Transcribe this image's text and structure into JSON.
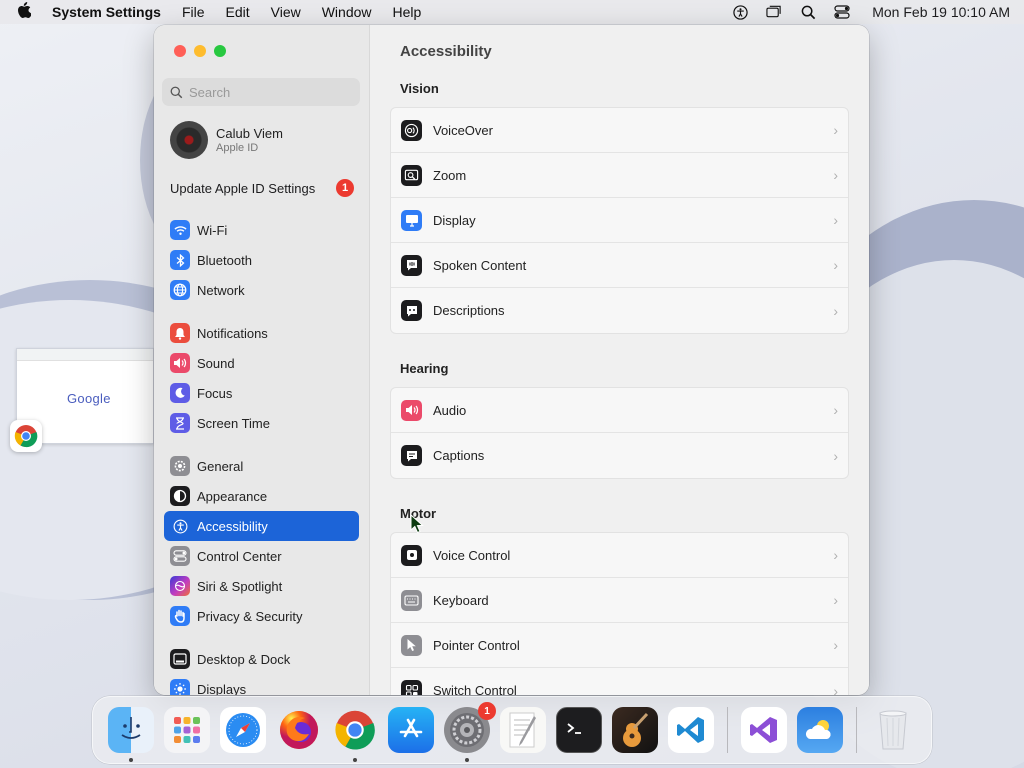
{
  "menubar": {
    "app_name": "System Settings",
    "menus": [
      "File",
      "Edit",
      "View",
      "Window",
      "Help"
    ],
    "clock": "Mon Feb 19  10:10 AM",
    "status_icons": [
      "accessibility-icon",
      "windows-icon",
      "search-icon",
      "control-center-icon"
    ]
  },
  "background": {
    "browser_thumbnail_text": "Google"
  },
  "sidebar": {
    "search_placeholder": "Search",
    "user": {
      "name": "Calub Viem",
      "subtitle": "Apple ID"
    },
    "update": {
      "label": "Update Apple ID Settings",
      "badge": "1"
    },
    "groups": [
      [
        {
          "label": "Wi-Fi",
          "icon": "wifi-icon",
          "color": "#2f7cf6"
        },
        {
          "label": "Bluetooth",
          "icon": "bluetooth-icon",
          "color": "#2f7cf6"
        },
        {
          "label": "Network",
          "icon": "globe-icon",
          "color": "#2f7cf6"
        }
      ],
      [
        {
          "label": "Notifications",
          "icon": "bell-icon",
          "color": "#eb4d3d"
        },
        {
          "label": "Sound",
          "icon": "speaker-icon",
          "color": "#eb4a6a"
        },
        {
          "label": "Focus",
          "icon": "moon-icon",
          "color": "#5e5ce6"
        },
        {
          "label": "Screen Time",
          "icon": "hourglass-icon",
          "color": "#5e5ce6"
        }
      ],
      [
        {
          "label": "General",
          "icon": "gear-icon",
          "color": "#8e8e93"
        },
        {
          "label": "Appearance",
          "icon": "appearance-icon",
          "color": "#1c1c1e"
        },
        {
          "label": "Accessibility",
          "icon": "accessibility-icon",
          "color": "#1c64d8",
          "active": true
        },
        {
          "label": "Control Center",
          "icon": "control-center-icon",
          "color": "#8e8e93"
        },
        {
          "label": "Siri & Spotlight",
          "icon": "siri-icon",
          "color": "#b23ab0"
        },
        {
          "label": "Privacy & Security",
          "icon": "hand-icon",
          "color": "#2f7cf6"
        }
      ],
      [
        {
          "label": "Desktop & Dock",
          "icon": "dock-icon",
          "color": "#1c1c1e"
        },
        {
          "label": "Displays",
          "icon": "sun-icon",
          "color": "#2f7cf6"
        }
      ]
    ]
  },
  "content": {
    "title": "Accessibility",
    "sections": [
      {
        "heading": "Vision",
        "rows": [
          {
            "label": "VoiceOver",
            "icon": "voiceover-icon",
            "color": "#1c1c1e"
          },
          {
            "label": "Zoom",
            "icon": "zoom-icon",
            "color": "#1c1c1e"
          },
          {
            "label": "Display",
            "icon": "display-icon",
            "color": "#2f7cf6"
          },
          {
            "label": "Spoken Content",
            "icon": "spoken-content-icon",
            "color": "#1c1c1e"
          },
          {
            "label": "Descriptions",
            "icon": "descriptions-icon",
            "color": "#1c1c1e"
          }
        ]
      },
      {
        "heading": "Hearing",
        "rows": [
          {
            "label": "Audio",
            "icon": "speaker-icon",
            "color": "#eb4a6a"
          },
          {
            "label": "Captions",
            "icon": "captions-icon",
            "color": "#1c1c1e"
          }
        ]
      },
      {
        "heading": "Motor",
        "rows": [
          {
            "label": "Voice Control",
            "icon": "voice-control-icon",
            "color": "#1c1c1e"
          },
          {
            "label": "Keyboard",
            "icon": "keyboard-icon",
            "color": "#8e8e93"
          },
          {
            "label": "Pointer Control",
            "icon": "pointer-icon",
            "color": "#8e8e93"
          },
          {
            "label": "Switch Control",
            "icon": "switch-control-icon",
            "color": "#1c1c1e"
          }
        ]
      }
    ]
  },
  "dock": {
    "apps": [
      {
        "name": "finder",
        "icon": "finder-icon",
        "running": true
      },
      {
        "name": "launchpad",
        "icon": "launchpad-icon",
        "running": false
      },
      {
        "name": "safari",
        "icon": "safari-icon",
        "running": false
      },
      {
        "name": "firefox",
        "icon": "firefox-icon",
        "running": false
      },
      {
        "name": "chrome",
        "icon": "chrome-icon",
        "running": true
      },
      {
        "name": "app-store",
        "icon": "app-store-icon",
        "running": false
      },
      {
        "name": "system-settings",
        "icon": "system-settings-icon",
        "running": true,
        "badge": "1"
      },
      {
        "name": "textedit",
        "icon": "textedit-icon",
        "running": false
      },
      {
        "name": "terminal",
        "icon": "terminal-icon",
        "running": false
      },
      {
        "name": "garageband",
        "icon": "garageband-icon",
        "running": false
      },
      {
        "name": "vscode",
        "icon": "vscode-icon",
        "running": false
      }
    ],
    "extra": [
      {
        "name": "visual-studio",
        "icon": "visual-studio-icon"
      },
      {
        "name": "weather",
        "icon": "weather-icon"
      }
    ],
    "trash": {
      "name": "trash",
      "icon": "trash-icon"
    }
  }
}
